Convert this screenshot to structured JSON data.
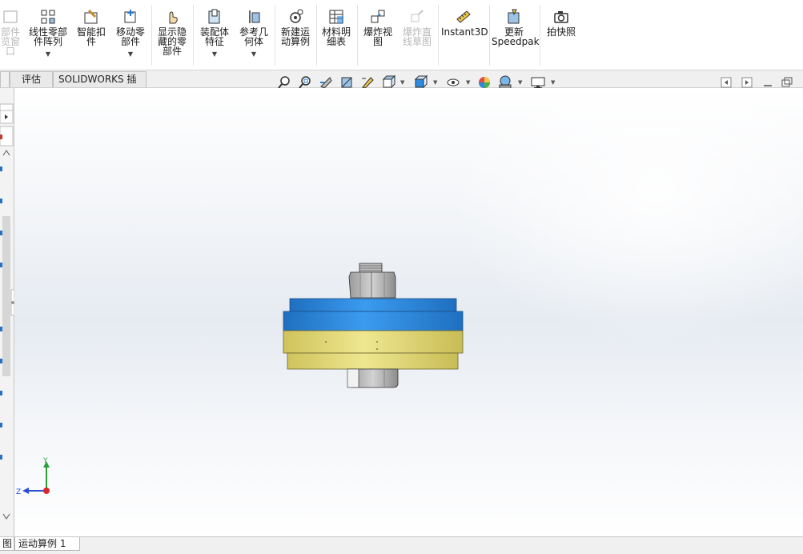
{
  "ribbon": {
    "cut_label": "部件\n览窗\n口",
    "linear_pattern_label": "线性零部\n件阵列",
    "smart_fastener_label": "智能扣\n件",
    "move_component_label": "移动零\n部件",
    "show_hidden_label": "显示隐\n藏的零\n部件",
    "assembly_feature_label": "装配体\n特征",
    "reference_geometry_label": "参考几\n何体",
    "new_motion_study_label": "新建运\n动算例",
    "bom_label": "材料明\n细表",
    "exploded_view_label": "爆炸视\n图",
    "explode_line_label": "爆炸直\n线草图",
    "instant3d_label": "Instant3D",
    "update_speedpak_label": "更新\nSpeedpak",
    "snapshot_label": "拍快照"
  },
  "tabs": {
    "evaluate": "评估",
    "solidworks_addins": "SOLIDWORKS 插件"
  },
  "bottom_tabs": {
    "model": "图",
    "motion_study": "运动算例 1"
  },
  "triad": {
    "y": "Y",
    "z": "Z"
  },
  "colors": {
    "plate_blue": "#2e8ae0",
    "plate_yellow": "#e6dc7a",
    "nut_gray": "#a9a9a9"
  }
}
